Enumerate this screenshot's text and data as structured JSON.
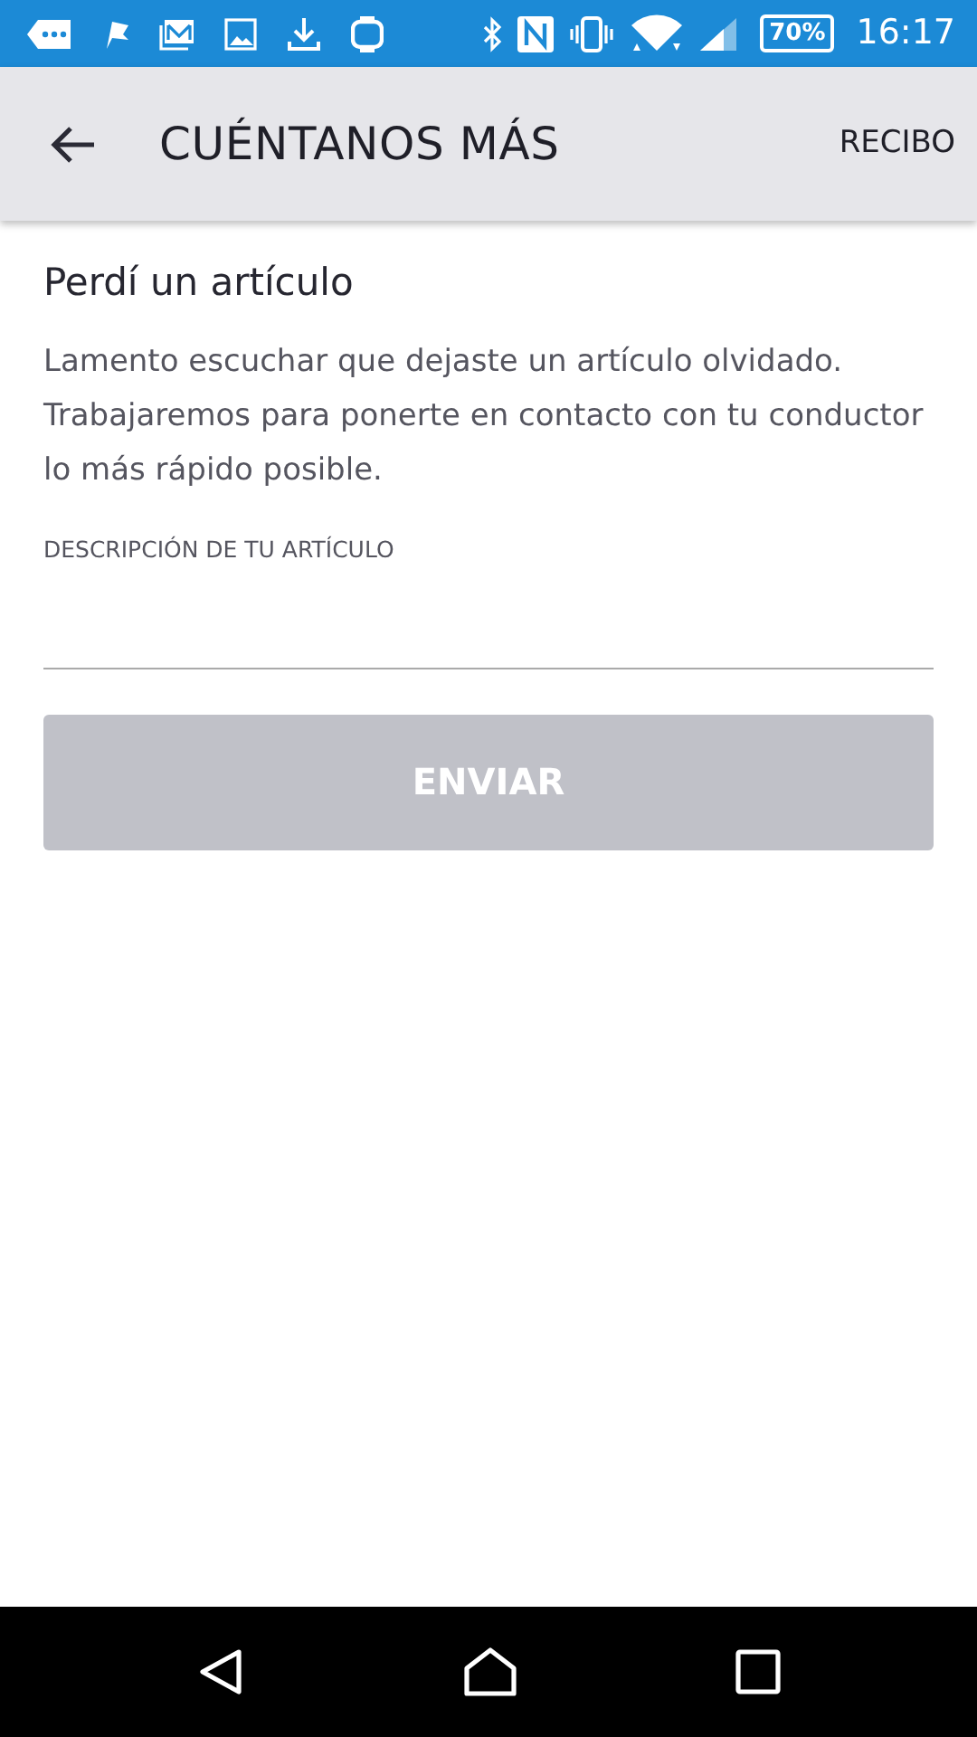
{
  "status_bar": {
    "battery": "70%",
    "time": "16:17"
  },
  "toolbar": {
    "title": "CUÉNTANOS MÁS",
    "action": "RECIBO"
  },
  "heading": "Perdí un artículo",
  "message": "Lamento escuchar que dejaste un artículo olvidado. Trabajaremos para ponerte en contacto con tu conductor lo más rápido posible.",
  "field": {
    "label": "DESCRIPCIÓN DE TU ARTÍCULO"
  },
  "submit": {
    "label": "ENVIAR",
    "disabled": true
  }
}
